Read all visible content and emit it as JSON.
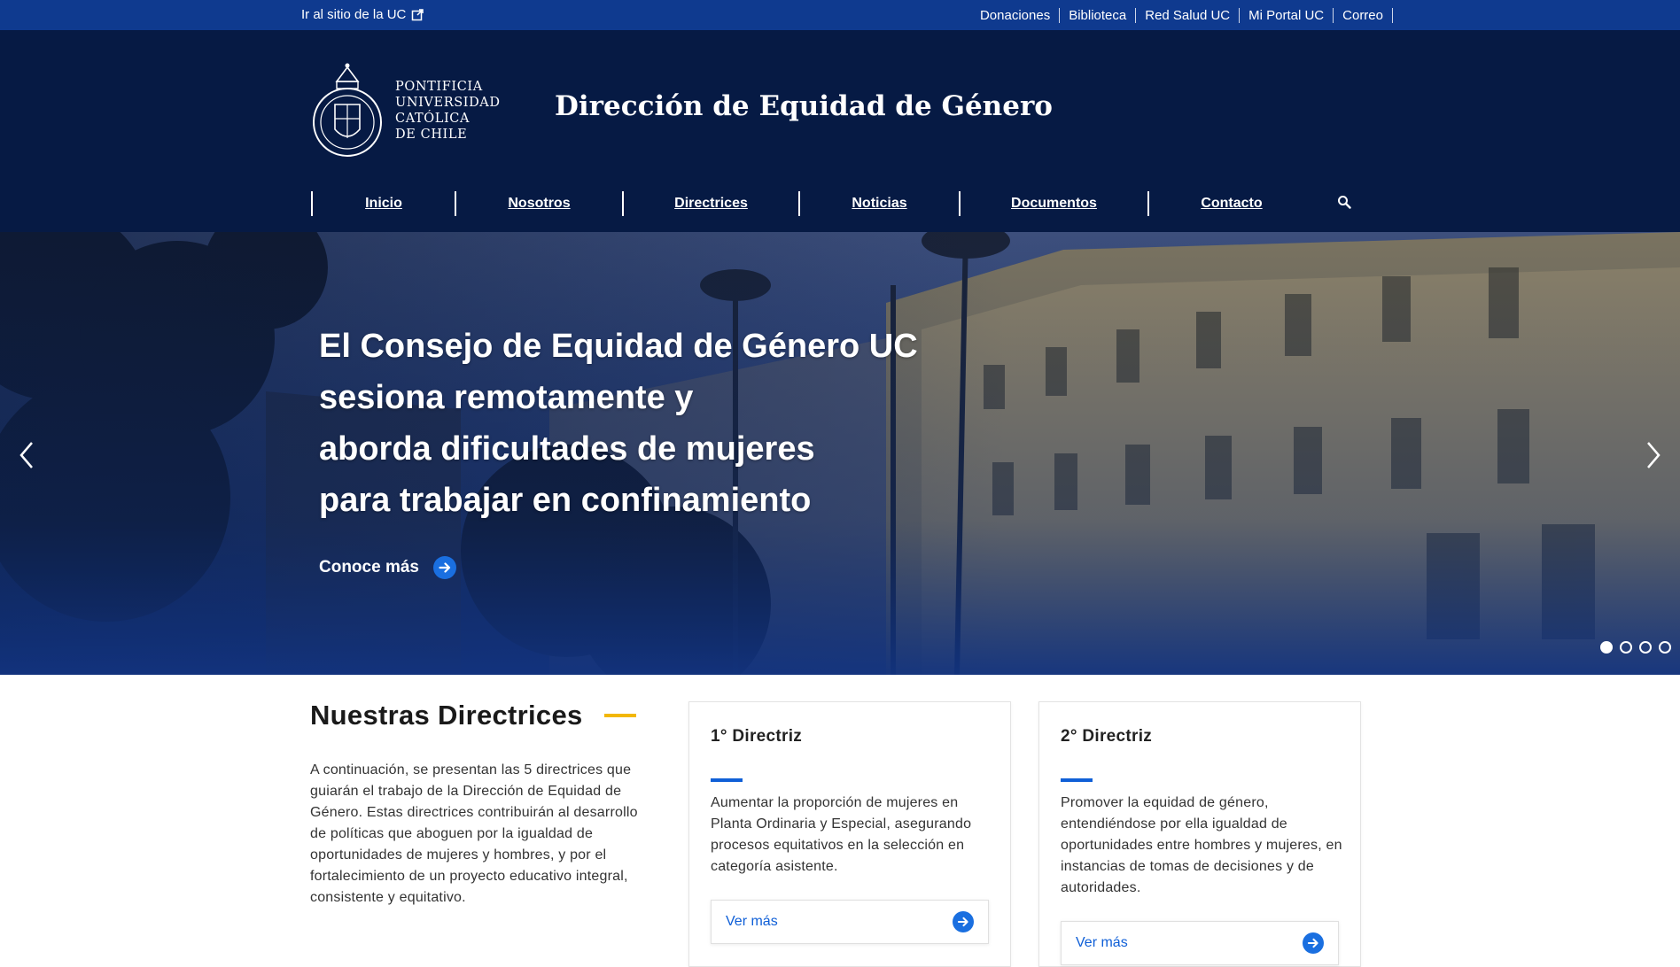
{
  "topbar": {
    "left_link": "Ir al sitio de la UC",
    "links": [
      "Donaciones",
      "Biblioteca",
      "Red Salud UC",
      "Mi Portal UC",
      "Correo"
    ]
  },
  "header": {
    "logo_lines": [
      "PONTIFICIA",
      "UNIVERSIDAD",
      "CATÓLICA",
      "DE CHILE"
    ],
    "site_title": "Dirección de Equidad de Género"
  },
  "nav": {
    "items": [
      "Inicio",
      "Nosotros",
      "Directrices",
      "Noticias",
      "Documentos",
      "Contacto"
    ]
  },
  "hero": {
    "title_lines": [
      "El Consejo de Equidad de Género UC",
      "sesiona remotamente y",
      "aborda dificultades de mujeres",
      "para trabajar en confinamiento"
    ],
    "cta": "Conoce más",
    "slide_count": 4,
    "active_slide": 1
  },
  "section": {
    "title": "Nuestras Directrices",
    "intro": "A continuación, se presentan las 5 directrices que guiarán el trabajo de la Dirección de Equidad de Género. Estas directrices contribuirán al desarrollo de políticas que aboguen por la igualdad de oportunidades de mujeres y hombres, y por el fortalecimiento de un proyecto educativo integral, consistente y equitativo."
  },
  "cards": [
    {
      "title": "1° Directriz",
      "text": "Aumentar la proporción de mujeres en Planta Ordinaria y Especial, asegurando procesos equitativos en la selección en categoría asistente.",
      "more": "Ver más"
    },
    {
      "title": "2° Directriz",
      "text": "Promover la equidad de género, entendiéndose por ella igualdad de oportunidades entre hombres y mujeres, en instancias de tomas de decisiones y de autoridades.",
      "more": "Ver más"
    }
  ],
  "colors": {
    "topbar": "#0f3a8f",
    "header": "#061a44",
    "accent_yellow": "#f2b705",
    "accent_blue": "#0f5fd7"
  },
  "icons": {
    "external": "external-link-icon",
    "search": "search-icon",
    "arrow": "arrow-right-circle-icon",
    "prev": "chevron-left-icon",
    "next": "chevron-right-icon"
  }
}
